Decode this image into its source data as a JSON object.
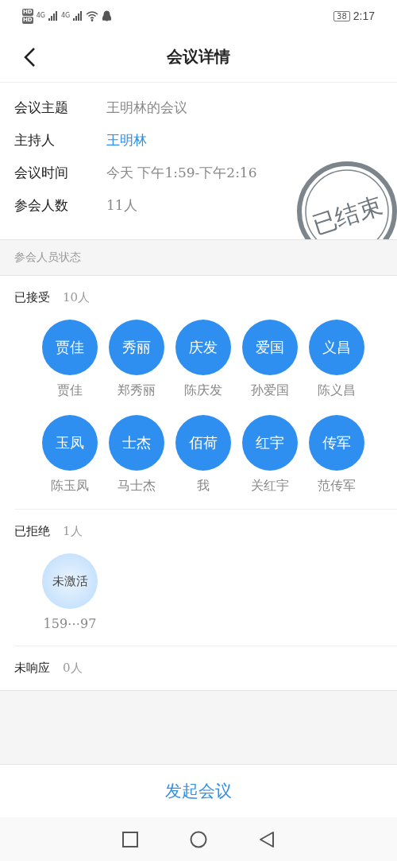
{
  "status_bar": {
    "hd_badges": [
      "HD",
      "HD"
    ],
    "networks": [
      "4G",
      "4G"
    ],
    "battery": "38",
    "time": "2:17"
  },
  "header": {
    "title": "会议详情"
  },
  "info": [
    {
      "label": "会议主题",
      "value": "王明林的会议",
      "kind": "text"
    },
    {
      "label": "主持人",
      "value": "王明林",
      "kind": "link"
    },
    {
      "label": "会议时间",
      "value": "今天 下午1:59-下午2:16",
      "kind": "text"
    },
    {
      "label": "参会人数",
      "value": "11人",
      "kind": "text"
    }
  ],
  "stamp": {
    "text": "已结束"
  },
  "section_title": "参会人员状态",
  "groups": [
    {
      "label": "已接受",
      "count": "10人",
      "members": [
        {
          "avatar": "贾佳",
          "name": "贾佳",
          "activated": true
        },
        {
          "avatar": "秀丽",
          "name": "郑秀丽",
          "activated": true
        },
        {
          "avatar": "庆发",
          "name": "陈庆发",
          "activated": true
        },
        {
          "avatar": "爱国",
          "name": "孙爱国",
          "activated": true
        },
        {
          "avatar": "义昌",
          "name": "陈义昌",
          "activated": true
        },
        {
          "avatar": "玉凤",
          "name": "陈玉凤",
          "activated": true
        },
        {
          "avatar": "士杰",
          "name": "马士杰",
          "activated": true
        },
        {
          "avatar": "佰荷",
          "name": "我",
          "activated": true
        },
        {
          "avatar": "红宇",
          "name": "关红宇",
          "activated": true
        },
        {
          "avatar": "传军",
          "name": "范传军",
          "activated": true
        }
      ]
    },
    {
      "label": "已拒绝",
      "count": "1人",
      "members": [
        {
          "avatar": "未激活",
          "name": "159⋯97",
          "activated": false
        }
      ]
    },
    {
      "label": "未响应",
      "count": "0人"
    }
  ],
  "action_button": "发起会议"
}
